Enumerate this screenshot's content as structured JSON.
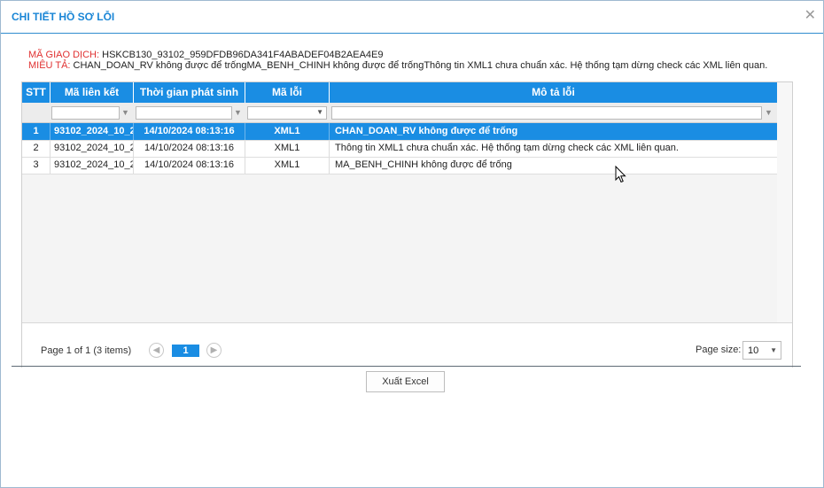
{
  "dialog": {
    "title": "CHI TIẾT HỒ SƠ LỖI"
  },
  "info": {
    "ma_giao_dich_label": "MÃ GIAO DỊCH:",
    "ma_giao_dich_value": "HSKCB130_93102_959DFDB96DA341F4ABADEF04B2AEA4E9",
    "mieu_ta_label": "MIÊU TẢ:",
    "mieu_ta_value": "CHAN_DOAN_RV không được để trốngMA_BENH_CHINH không được để trốngThông tin XML1 chưa chuẩn xác. Hệ thống tạm dừng check các XML liên quan."
  },
  "grid": {
    "columns": [
      "STT",
      "Mã liên kết",
      "Thời gian phát sinh",
      "Mã lỗi",
      "Mô tả lỗi"
    ],
    "rows": [
      {
        "stt": "1",
        "ma_lien_ket": "93102_2024_10_2",
        "thoi_gian": "14/10/2024 08:13:16",
        "ma_loi": "XML1",
        "mo_ta": "CHAN_DOAN_RV không được để trống"
      },
      {
        "stt": "2",
        "ma_lien_ket": "93102_2024_10_2",
        "thoi_gian": "14/10/2024 08:13:16",
        "ma_loi": "XML1",
        "mo_ta": "Thông tin XML1 chưa chuẩn xác. Hệ thống tạm dừng check các XML liên quan."
      },
      {
        "stt": "3",
        "ma_lien_ket": "93102_2024_10_2",
        "thoi_gian": "14/10/2024 08:13:16",
        "ma_loi": "XML1",
        "mo_ta": "MA_BENH_CHINH không được để trống"
      }
    ],
    "selected_row": 0
  },
  "pager": {
    "info": "Page 1 of 1 (3 items)",
    "current_page": "1",
    "page_size_label": "Page size:",
    "page_size_value": "10"
  },
  "actions": {
    "export_label": "Xuất Excel"
  },
  "icons": {
    "close": "close-icon",
    "filter": "filter-icon",
    "dropdown": "chevron-down-icon",
    "prev": "chevron-left-icon",
    "next": "chevron-right-icon"
  },
  "colors": {
    "accent": "#1a8de3",
    "title": "#1a86d6",
    "label_red": "#e03131"
  }
}
